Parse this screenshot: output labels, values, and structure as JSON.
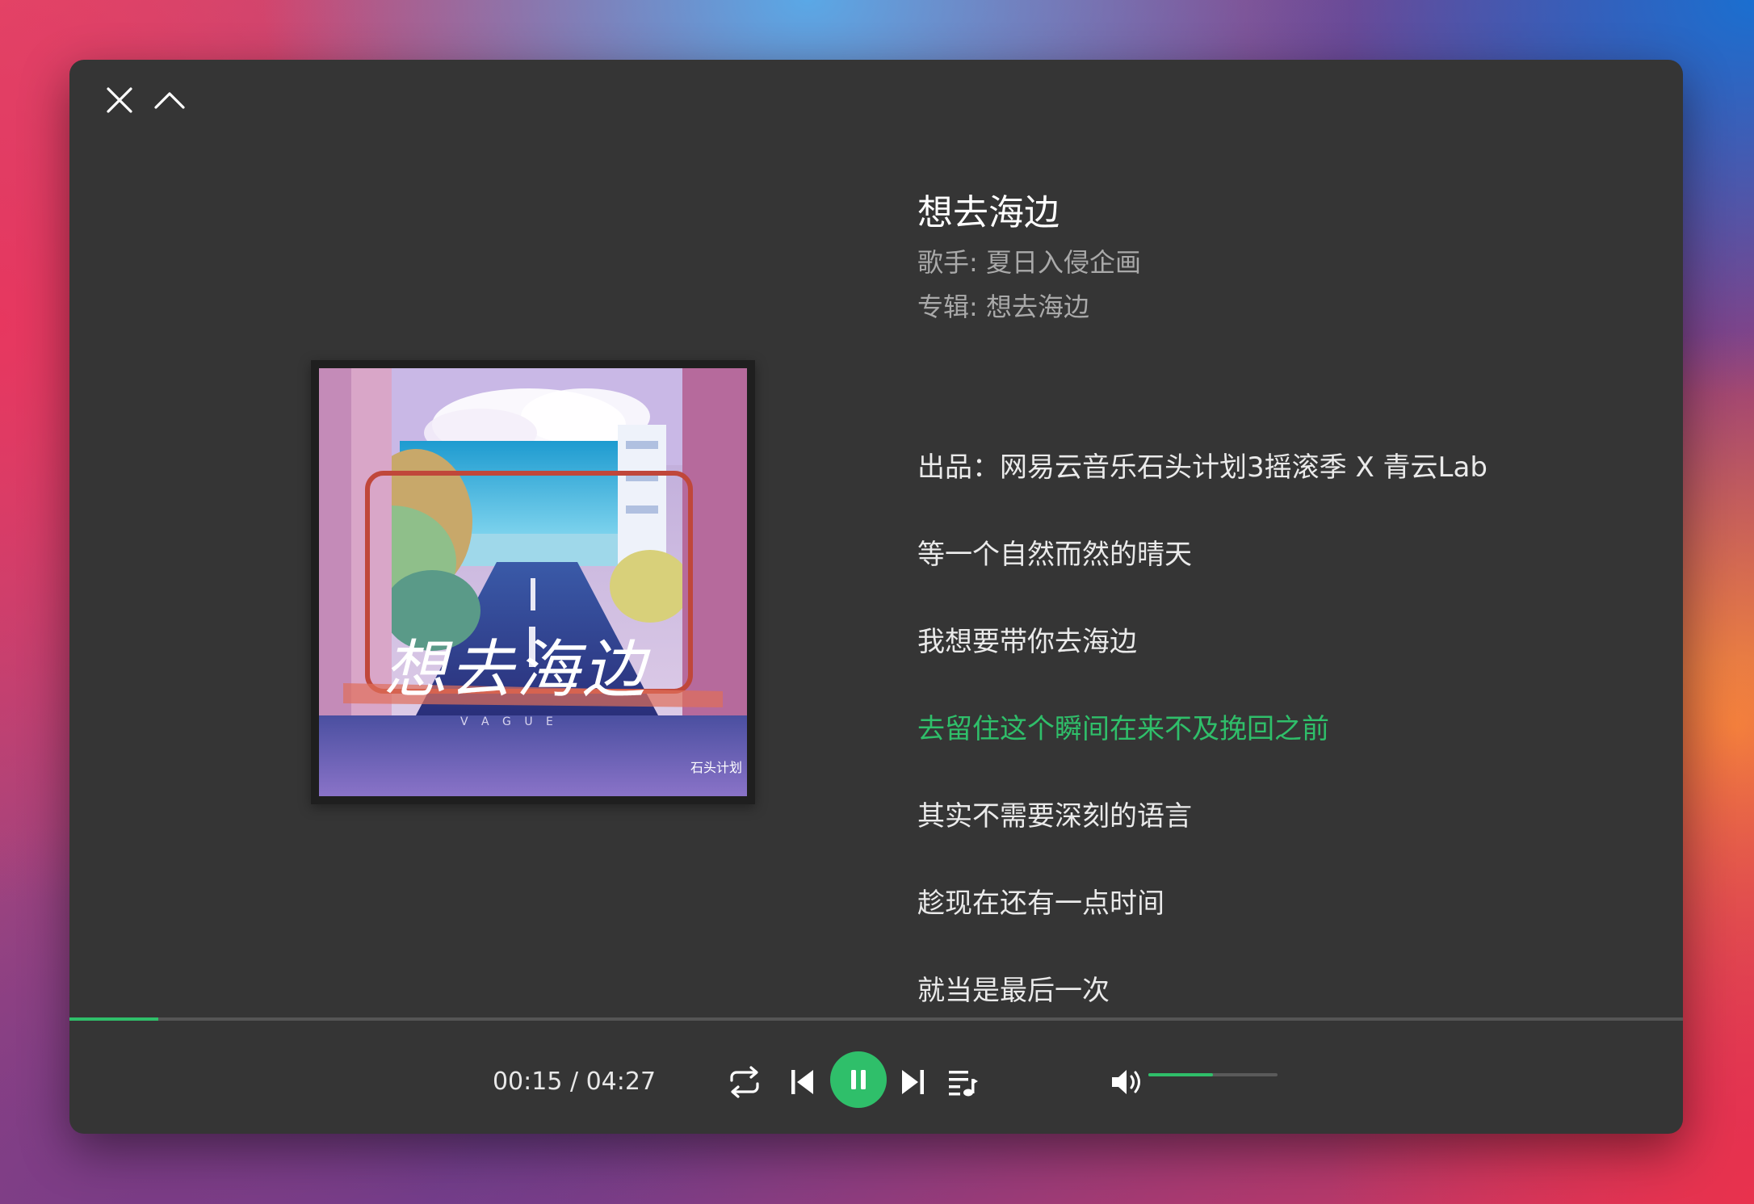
{
  "song": {
    "title": "想去海边",
    "artist": "歌手: 夏日入侵企画",
    "album": "专辑: 想去海边"
  },
  "album_art": {
    "title_text": "想去海边",
    "subtitle_text": "V A G U E",
    "logo_text": "石头计划"
  },
  "lyrics": [
    {
      "text": "出品：网易云音乐石头计划3摇滚季 X 青云Lab",
      "active": false
    },
    {
      "text": "等一个自然而然的晴天",
      "active": false
    },
    {
      "text": "我想要带你去海边",
      "active": false
    },
    {
      "text": "去留住这个瞬间在来不及挽回之前",
      "active": true
    },
    {
      "text": "其实不需要深刻的语言",
      "active": false
    },
    {
      "text": "趁现在还有一点时间",
      "active": false
    },
    {
      "text": "就当是最后一次",
      "active": false
    }
  ],
  "player": {
    "time_display": "00:15 / 04:27",
    "progress_percent": 5.5,
    "volume_percent": 50,
    "state": "playing"
  },
  "icons": {
    "close": "close-icon",
    "collapse": "chevron-up-icon",
    "repeat": "repeat-icon",
    "prev": "skip-previous-icon",
    "pause": "pause-icon",
    "next": "skip-next-icon",
    "playlist": "playlist-icon",
    "volume": "volume-icon"
  },
  "colors": {
    "accent": "#2fbf6a",
    "window_bg": "#353535",
    "text_primary": "#ffffff",
    "text_secondary": "#a9a9a9"
  }
}
